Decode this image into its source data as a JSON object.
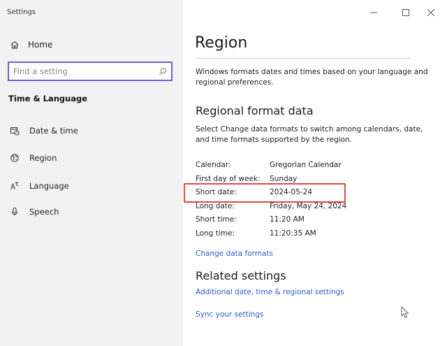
{
  "window": {
    "title": "Settings"
  },
  "sidebar": {
    "home_label": "Home",
    "search": {
      "placeholder": "Find a setting"
    },
    "section_title": "Time & Language",
    "items": [
      {
        "label": "Date & time",
        "icon": "calendar-clock-icon"
      },
      {
        "label": "Region",
        "icon": "globe-icon"
      },
      {
        "label": "Language",
        "icon": "language-icon"
      },
      {
        "label": "Speech",
        "icon": "microphone-icon"
      }
    ]
  },
  "main": {
    "title": "Region",
    "intro": "Windows formats dates and times based on your language and regional preferences.",
    "regional_format": {
      "heading": "Regional format data",
      "description": "Select Change data formats to switch among calendars, date, and time formats supported by the region.",
      "rows": [
        {
          "label": "Calendar:",
          "value": "Gregorian Calendar"
        },
        {
          "label": "First day of week:",
          "value": "Sunday"
        },
        {
          "label": "Short date:",
          "value": "2024-05-24"
        },
        {
          "label": "Long date:",
          "value": "Friday, May 24, 2024"
        },
        {
          "label": "Short time:",
          "value": "11:20 AM"
        },
        {
          "label": "Long time:",
          "value": "11:20:35 AM"
        }
      ],
      "change_link": "Change data formats"
    },
    "related": {
      "heading": "Related settings",
      "links": [
        "Additional date, time & regional settings",
        "Sync your settings"
      ]
    }
  },
  "colors": {
    "accent_link": "#2b5ec4",
    "search_border": "#6b5fd6",
    "highlight": "#e04848",
    "sidebar_bg": "#f2f2f2"
  }
}
